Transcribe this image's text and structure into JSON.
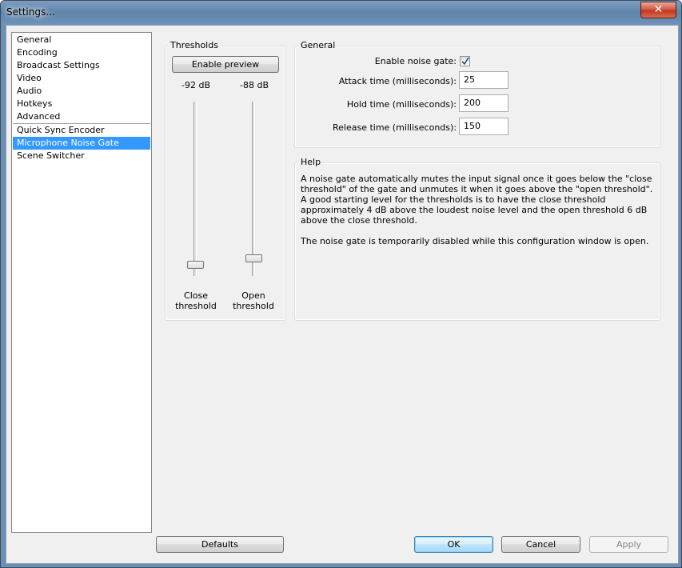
{
  "window": {
    "title": "Settings..."
  },
  "nav": {
    "items": [
      "General",
      "Encoding",
      "Broadcast Settings",
      "Video",
      "Audio",
      "Hotkeys",
      "Advanced"
    ],
    "plugins": [
      "Quick Sync Encoder",
      "Microphone Noise Gate",
      "Scene Switcher"
    ],
    "selected": "Microphone Noise Gate"
  },
  "thresholds": {
    "group_label": "Thresholds",
    "preview_button": "Enable preview",
    "close_db": "-92 dB",
    "open_db": "-88 dB",
    "close_caption_line1": "Close",
    "close_caption_line2": "threshold",
    "open_caption_line1": "Open",
    "open_caption_line2": "threshold"
  },
  "general": {
    "group_label": "General",
    "enable_label": "Enable noise gate:",
    "enable_checked": true,
    "attack_label": "Attack time (milliseconds):",
    "attack_value": "25",
    "hold_label": "Hold time (milliseconds):",
    "hold_value": "200",
    "release_label": "Release time (milliseconds):",
    "release_value": "150"
  },
  "help": {
    "group_label": "Help",
    "paragraph1": "A noise gate automatically mutes the input signal once it goes below the \"close threshold\" of the gate and unmutes it when it goes above the \"open threshold\". A good starting level for the thresholds is to have the close threshold approximately 4 dB above the loudest noise level and the open threshold 6 dB above the close threshold.",
    "paragraph2": "The noise gate is temporarily disabled while this configuration window is open."
  },
  "buttons": {
    "defaults": "Defaults",
    "ok": "OK",
    "cancel": "Cancel",
    "apply": "Apply"
  }
}
